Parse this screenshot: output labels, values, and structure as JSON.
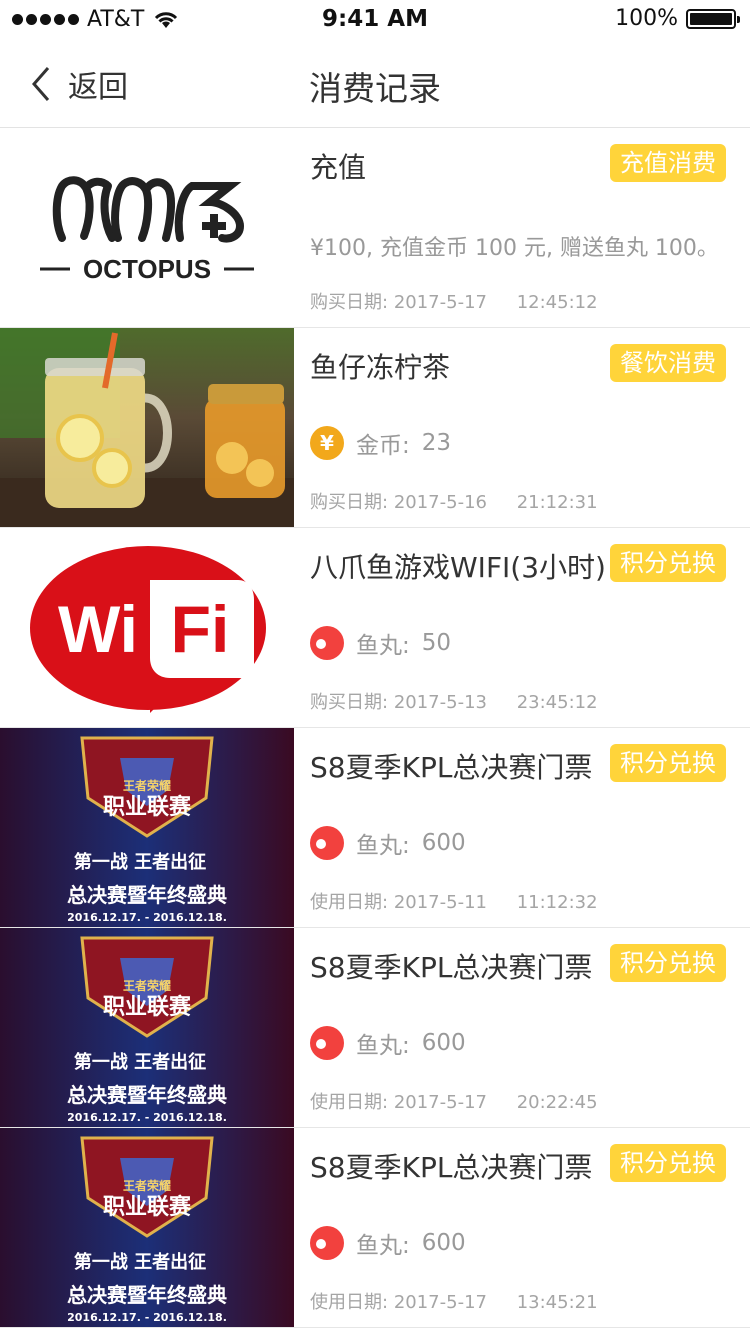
{
  "status_bar": {
    "carrier": "AT&T",
    "time": "9:41 AM",
    "battery": "100%"
  },
  "nav": {
    "back_label": "返回",
    "title": "消费记录"
  },
  "records": [
    {
      "title": "充值",
      "tag": "充值消费",
      "desc": "¥100, 充值金币 100 元, 赠送鱼丸 100。",
      "date_label": "购买日期:",
      "date": "2017-5-17",
      "time": "12:45:12",
      "thumb": "octopus-logo"
    },
    {
      "title": "鱼仔冻柠茶",
      "tag": "餐饮消费",
      "currency_icon": "coin-icon",
      "currency": "金币:",
      "amount": "23",
      "date_label": "购买日期:",
      "date": "2017-5-16",
      "time": "21:12:31",
      "thumb": "lemon-tea-photo"
    },
    {
      "title": "八爪鱼游戏WIFI(3小时)",
      "tag": "积分兑换",
      "currency_icon": "fishball-icon",
      "currency": "鱼丸:",
      "amount": "50",
      "date_label": "购买日期:",
      "date": "2017-5-13",
      "time": "23:45:12",
      "thumb": "wifi-logo"
    },
    {
      "title": "S8夏季KPL总决赛门票",
      "tag": "积分兑换",
      "currency_icon": "fishball-icon",
      "currency": "鱼丸:",
      "amount": "600",
      "date_label": "使用日期:",
      "date": "2017-5-11",
      "time": "11:12:32",
      "thumb": "kpl-poster"
    },
    {
      "title": "S8夏季KPL总决赛门票",
      "tag": "积分兑换",
      "currency_icon": "fishball-icon",
      "currency": "鱼丸:",
      "amount": "600",
      "date_label": "使用日期:",
      "date": "2017-5-17",
      "time": "20:22:45",
      "thumb": "kpl-poster"
    },
    {
      "title": "S8夏季KPL总决赛门票",
      "tag": "积分兑换",
      "currency_icon": "fishball-icon",
      "currency": "鱼丸:",
      "amount": "600",
      "date_label": "使用日期:",
      "date": "2017-5-17",
      "time": "13:45:21",
      "thumb": "kpl-poster"
    }
  ],
  "thumb_text": {
    "octopus": "OCTOPUS",
    "wifi_a": "Wi",
    "wifi_b": "Fi",
    "kpl_top": "王者荣耀",
    "kpl_main": "职业联赛",
    "kpl_sub": "第一战 王者出征",
    "kpl_final": "总决赛暨年终盛典",
    "kpl_date": "2016.12.17. - 2016.12.18."
  },
  "colors": {
    "tag_bg": "#FFD43A",
    "coin": "#F2A81B",
    "fishball": "#F2413E"
  }
}
